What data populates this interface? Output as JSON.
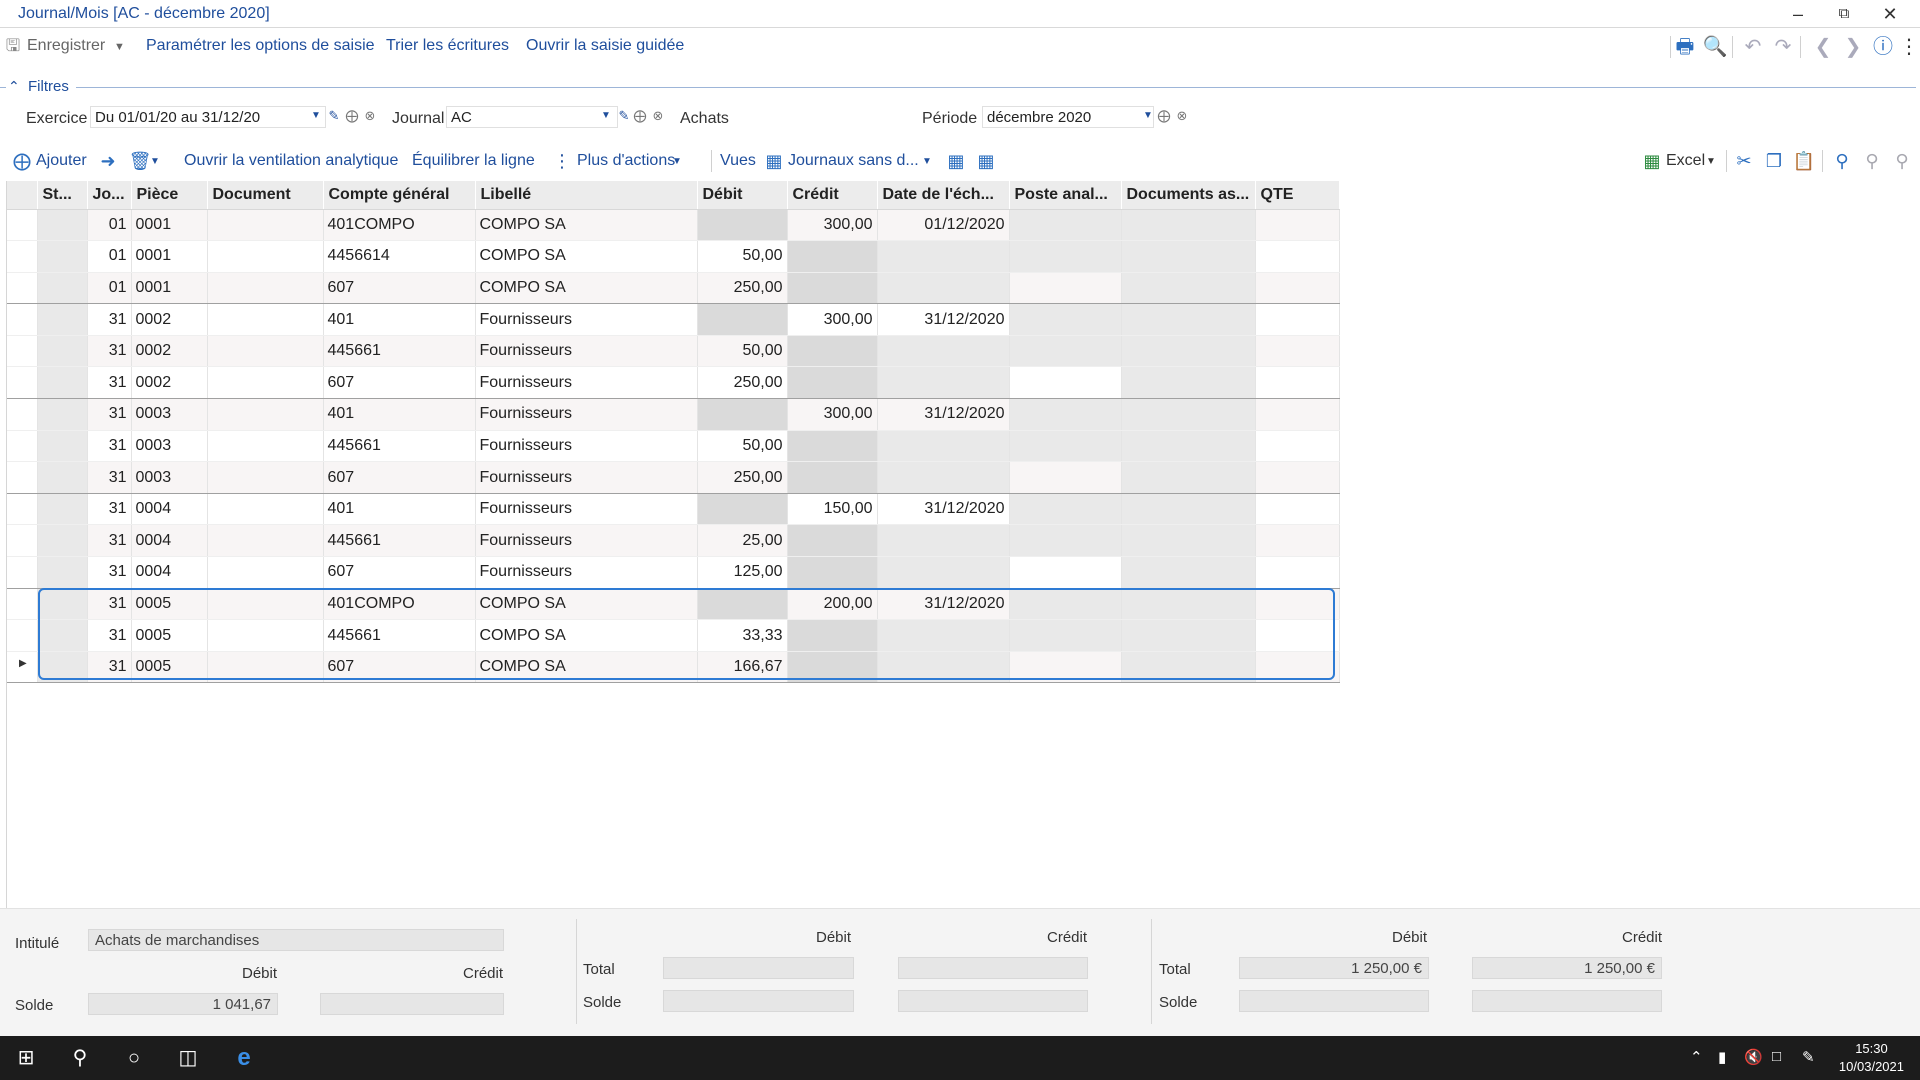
{
  "window": {
    "title": "Journal/Mois [AC - décembre 2020]"
  },
  "toolbar": {
    "save_label": "Enregistrer",
    "items": [
      "Paramétrer les options de saisie",
      "Trier les écritures",
      "Ouvrir la saisie guidée"
    ]
  },
  "filters": {
    "title": "Filtres",
    "exercice_label": "Exercice",
    "exercice_value": "Du 01/01/20 au 31/12/20",
    "journal_label": "Journal",
    "journal_value": "AC",
    "journal_name": "Achats",
    "periode_label": "Période",
    "periode_value": "décembre 2020"
  },
  "actions": {
    "add": "Ajouter",
    "analytique": "Ouvrir la ventilation analytique",
    "equilibrer": "Équilibrer la ligne",
    "plus": "Plus d'actions",
    "vues_label": "Vues",
    "vues_value": "Journaux sans d...",
    "excel": "Excel"
  },
  "grid": {
    "columns": [
      "St...",
      "Jo...",
      "Pièce",
      "Document",
      "Compte général",
      "Libellé",
      "Débit",
      "Crédit",
      "Date de l'éch...",
      "Poste anal...",
      "Documents as...",
      "QTE"
    ],
    "rows": [
      {
        "jour": "01",
        "piece": "0001",
        "compte": "401COMPO",
        "libelle": "COMPO SA",
        "debit": "",
        "credit": "300,00",
        "echeance": "01/12/2020"
      },
      {
        "jour": "01",
        "piece": "0001",
        "compte": "4456614",
        "libelle": "COMPO SA",
        "debit": "50,00",
        "credit": "",
        "echeance": ""
      },
      {
        "jour": "01",
        "piece": "0001",
        "compte": "607",
        "libelle": "COMPO SA",
        "debit": "250,00",
        "credit": "",
        "echeance": ""
      },
      {
        "jour": "31",
        "piece": "0002",
        "compte": "401",
        "libelle": "Fournisseurs",
        "debit": "",
        "credit": "300,00",
        "echeance": "31/12/2020"
      },
      {
        "jour": "31",
        "piece": "0002",
        "compte": "445661",
        "libelle": "Fournisseurs",
        "debit": "50,00",
        "credit": "",
        "echeance": ""
      },
      {
        "jour": "31",
        "piece": "0002",
        "compte": "607",
        "libelle": "Fournisseurs",
        "debit": "250,00",
        "credit": "",
        "echeance": ""
      },
      {
        "jour": "31",
        "piece": "0003",
        "compte": "401",
        "libelle": "Fournisseurs",
        "debit": "",
        "credit": "300,00",
        "echeance": "31/12/2020"
      },
      {
        "jour": "31",
        "piece": "0003",
        "compte": "445661",
        "libelle": "Fournisseurs",
        "debit": "50,00",
        "credit": "",
        "echeance": ""
      },
      {
        "jour": "31",
        "piece": "0003",
        "compte": "607",
        "libelle": "Fournisseurs",
        "debit": "250,00",
        "credit": "",
        "echeance": ""
      },
      {
        "jour": "31",
        "piece": "0004",
        "compte": "401",
        "libelle": "Fournisseurs",
        "debit": "",
        "credit": "150,00",
        "echeance": "31/12/2020"
      },
      {
        "jour": "31",
        "piece": "0004",
        "compte": "445661",
        "libelle": "Fournisseurs",
        "debit": "25,00",
        "credit": "",
        "echeance": ""
      },
      {
        "jour": "31",
        "piece": "0004",
        "compte": "607",
        "libelle": "Fournisseurs",
        "debit": "125,00",
        "credit": "",
        "echeance": ""
      },
      {
        "jour": "31",
        "piece": "0005",
        "compte": "401COMPO",
        "libelle": "COMPO SA",
        "debit": "",
        "credit": "200,00",
        "echeance": "31/12/2020"
      },
      {
        "jour": "31",
        "piece": "0005",
        "compte": "445661",
        "libelle": "COMPO SA",
        "debit": "33,33",
        "credit": "",
        "echeance": ""
      },
      {
        "jour": "31",
        "piece": "0005",
        "compte": "607",
        "libelle": "COMPO SA",
        "debit": "166,67",
        "credit": "",
        "echeance": ""
      }
    ]
  },
  "footer": {
    "intitule_label": "Intitulé",
    "intitule_value": "Achats de marchandises",
    "debit_label": "Débit",
    "credit_label": "Crédit",
    "solde_label": "Solde",
    "total_label": "Total",
    "solde_debit": "1 041,67",
    "total_debit": "1 250,00 €",
    "total_credit": "1 250,00 €"
  },
  "taskbar": {
    "time": "15:30",
    "date": "10/03/2021"
  }
}
